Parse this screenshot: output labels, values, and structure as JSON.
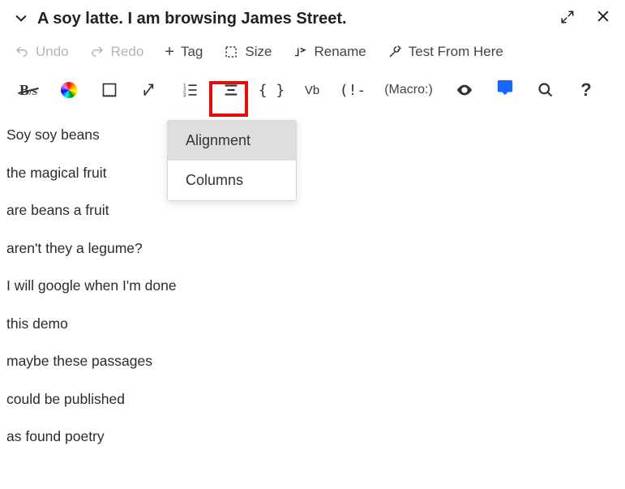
{
  "title": "A soy latte. I am browsing James Street.",
  "toolbar": {
    "undo": "Undo",
    "redo": "Redo",
    "tag": "Tag",
    "size": "Size",
    "rename": "Rename",
    "test": "Test From Here"
  },
  "toolrow": {
    "macro_label": "(Macro:)"
  },
  "dropdown": {
    "items": [
      "Alignment",
      "Columns"
    ]
  },
  "content": [
    "Soy soy beans",
    "the magical fruit",
    "are beans a fruit",
    "aren't they a legume?",
    "I will google when I'm done",
    "this demo",
    "maybe these passages",
    "could be published",
    "as found poetry"
  ]
}
